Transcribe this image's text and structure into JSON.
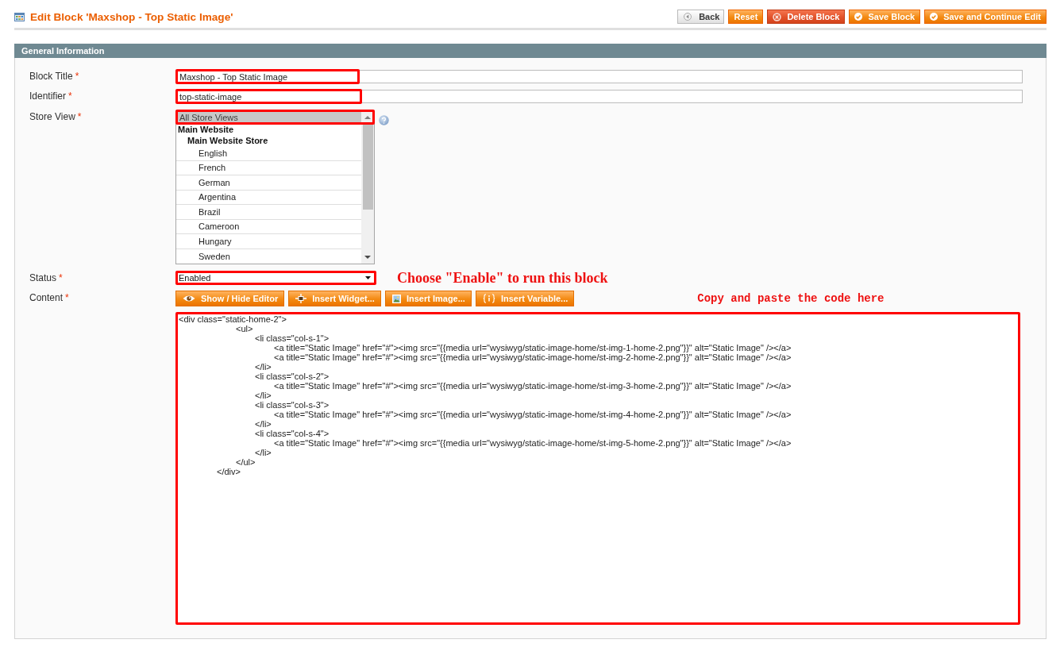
{
  "header": {
    "title": "Edit Block 'Maxshop - Top Static Image'",
    "buttons": [
      {
        "label": "Back",
        "kind": "back"
      },
      {
        "label": "Reset",
        "kind": "reset"
      },
      {
        "label": "Delete Block",
        "kind": "delete"
      },
      {
        "label": "Save Block",
        "kind": "save"
      },
      {
        "label": "Save and Continue Edit",
        "kind": "save_continue"
      }
    ]
  },
  "panel": {
    "title": "General Information",
    "fields": [
      {
        "kind": "text",
        "label": "Block Title",
        "required_mark": "*",
        "value": "Maxshop - Top Static Image",
        "highlighted": true
      },
      {
        "kind": "text",
        "label": "Identifier",
        "required_mark": "*",
        "value": "top-static-image",
        "highlighted": true
      },
      {
        "kind": "multiselect",
        "label": "Store View",
        "required_mark": "*",
        "highlighted": true,
        "help": true,
        "options": [
          {
            "kind": "option",
            "label": "All Store Views",
            "selected": true
          },
          {
            "kind": "group",
            "label": "Main Website",
            "children": [
              {
                "kind": "group",
                "label": "Main Website Store",
                "children": [
                  {
                    "kind": "option",
                    "label": "English",
                    "selected": false
                  },
                  {
                    "kind": "option",
                    "label": "French",
                    "selected": false
                  },
                  {
                    "kind": "option",
                    "label": "German",
                    "selected": false
                  },
                  {
                    "kind": "option",
                    "label": "Argentina",
                    "selected": false
                  },
                  {
                    "kind": "option",
                    "label": "Brazil",
                    "selected": false
                  },
                  {
                    "kind": "option",
                    "label": "Cameroon",
                    "selected": false
                  },
                  {
                    "kind": "option",
                    "label": "Hungary",
                    "selected": false
                  },
                  {
                    "kind": "option",
                    "label": "Sweden",
                    "selected": false
                  }
                ]
              }
            ]
          }
        ]
      },
      {
        "kind": "select",
        "label": "Status",
        "required_mark": "*",
        "value": "Enabled",
        "highlighted": true,
        "note": "Choose \"Enable\" to run this block"
      },
      {
        "kind": "editor",
        "label": "Content",
        "required_mark": "*",
        "buttons": [
          {
            "label": "Show / Hide Editor",
            "kind": "toggle_editor"
          },
          {
            "label": "Insert Widget...",
            "kind": "insert_widget"
          },
          {
            "label": "Insert Image...",
            "kind": "insert_image"
          },
          {
            "label": "Insert Variable...",
            "kind": "insert_variable"
          }
        ],
        "note": "Copy and paste the code here",
        "highlighted": true,
        "value": "<div class=\"static-home-2\">\n\t\t\t<ul>\n\t\t\t\t<li class=\"col-s-1\">\n\t\t\t\t\t<a title=\"Static Image\" href=\"#\"><img src=\"{{media url=\"wysiwyg/static-image-home/st-img-1-home-2.png\"}}\" alt=\"Static Image\" /></a>\n\t\t\t\t\t<a title=\"Static Image\" href=\"#\"><img src=\"{{media url=\"wysiwyg/static-image-home/st-img-2-home-2.png\"}}\" alt=\"Static Image\" /></a>\n\t\t\t\t</li>\n\t\t\t\t<li class=\"col-s-2\">\n\t\t\t\t\t<a title=\"Static Image\" href=\"#\"><img src=\"{{media url=\"wysiwyg/static-image-home/st-img-3-home-2.png\"}}\" alt=\"Static Image\" /></a>\n\t\t\t\t</li>\n\t\t\t\t<li class=\"col-s-3\">\n\t\t\t\t\t<a title=\"Static Image\" href=\"#\"><img src=\"{{media url=\"wysiwyg/static-image-home/st-img-4-home-2.png\"}}\" alt=\"Static Image\" /></a>\n\t\t\t\t</li>\n\t\t\t\t<li class=\"col-s-4\">\n\t\t\t\t\t<a title=\"Static Image\" href=\"#\"><img src=\"{{media url=\"wysiwyg/static-image-home/st-img-5-home-2.png\"}}\" alt=\"Static Image\" /></a>\n\t\t\t\t</li>\n\t\t\t</ul>\n\t\t</div>"
      }
    ]
  }
}
